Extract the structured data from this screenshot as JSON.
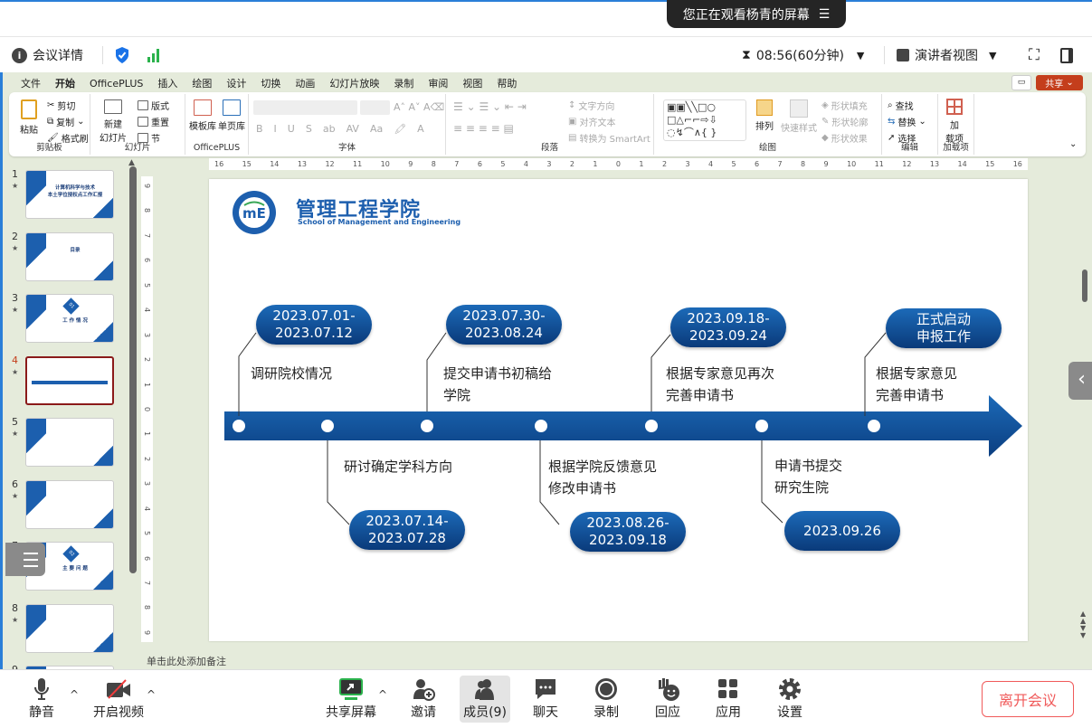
{
  "banner": {
    "text": "您正在观看杨青的屏幕"
  },
  "meeting_bar": {
    "details": "会议详情",
    "timer": "08:56(60分钟)",
    "view": "演讲者视图"
  },
  "ppt": {
    "tabs": [
      "文件",
      "开始",
      "OfficePLUS",
      "插入",
      "绘图",
      "设计",
      "切换",
      "动画",
      "幻灯片放映",
      "录制",
      "审阅",
      "视图",
      "帮助"
    ],
    "active_tab": "开始",
    "share": "共享",
    "ribbon": {
      "clipboard": {
        "paste": "粘贴",
        "cut": "剪切",
        "copy": "复制",
        "format_painter": "格式刷",
        "label": "剪贴板"
      },
      "slides": {
        "new_slide": "新建\n幻灯片",
        "layout": "版式",
        "reset": "重置",
        "section": "节",
        "label": "幻灯片"
      },
      "officeplus": {
        "template": "模板库",
        "single_page": "单页库",
        "label": "OfficePLUS"
      },
      "font": {
        "label": "字体",
        "bold": "B",
        "italic": "I",
        "underline": "U",
        "shadow": "S",
        "aa": "Aa"
      },
      "paragraph": {
        "text_direction": "文字方向",
        "align_text": "对齐文本",
        "smartart": "转换为 SmartArt",
        "label": "段落"
      },
      "drawing": {
        "arrange": "排列",
        "quick_styles": "快速样式",
        "shape_fill": "形状填充",
        "shape_outline": "形状轮廓",
        "shape_effects": "形状效果",
        "label": "绘图"
      },
      "editing": {
        "find": "查找",
        "replace": "替换",
        "select": "选择",
        "label": "编辑"
      },
      "addins": {
        "addins": "加\n载项",
        "label": "加载项"
      }
    },
    "ruler_h": [
      "16",
      "15",
      "14",
      "13",
      "12",
      "11",
      "10",
      "9",
      "8",
      "7",
      "6",
      "5",
      "4",
      "3",
      "2",
      "1",
      "0",
      "1",
      "2",
      "3",
      "4",
      "5",
      "6",
      "7",
      "8",
      "9",
      "10",
      "11",
      "12",
      "13",
      "14",
      "15",
      "16"
    ],
    "ruler_v": [
      "9",
      "8",
      "7",
      "6",
      "5",
      "4",
      "3",
      "2",
      "1",
      "0",
      "1",
      "2",
      "3",
      "4",
      "5",
      "6",
      "7",
      "8",
      "9"
    ],
    "thumbnails": [
      {
        "num": "1",
        "title": "计算机科学与技术\n本土学位授权点工作汇报"
      },
      {
        "num": "2",
        "title": "目录"
      },
      {
        "num": "3",
        "title": "工 作 情 况",
        "badge": "01"
      },
      {
        "num": "4",
        "selected": true
      },
      {
        "num": "5"
      },
      {
        "num": "6"
      },
      {
        "num": "7",
        "title": "主 要 问 题",
        "badge": "02"
      },
      {
        "num": "8"
      },
      {
        "num": "9"
      }
    ],
    "notes_placeholder": "单击此处添加备注"
  },
  "slide": {
    "logo_title": "管理工程学院",
    "logo_subtitle": "School of Management and Engineering",
    "milestones_top": [
      {
        "date": "2023.07.01-\n2023.07.12",
        "desc": "调研院校情况"
      },
      {
        "date": "2023.07.30-\n2023.08.24",
        "desc": "提交申请书初稿给\n学院"
      },
      {
        "date": "2023.09.18-\n2023.09.24",
        "desc": "根据专家意见再次\n完善申请书"
      },
      {
        "date": "正式启动\n申报工作",
        "desc": "根据专家意见\n完善申请书"
      }
    ],
    "milestones_bottom": [
      {
        "date": "2023.07.14-\n2023.07.28",
        "desc": "研讨确定学科方向"
      },
      {
        "date": "2023.08.26-\n2023.09.18",
        "desc": "根据学院反馈意见\n修改申请书"
      },
      {
        "date": "2023.09.26",
        "desc": "申请书提交\n研究生院"
      }
    ],
    "colors": {
      "primary": "#0b4a92",
      "light": "#1c6ab8"
    }
  },
  "toolbar": {
    "mute": "静音",
    "video": "开启视频",
    "share_screen": "共享屏幕",
    "invite": "邀请",
    "members": "成员(9)",
    "chat": "聊天",
    "record": "录制",
    "react": "回应",
    "apps": "应用",
    "settings": "设置",
    "leave": "离开会议"
  }
}
